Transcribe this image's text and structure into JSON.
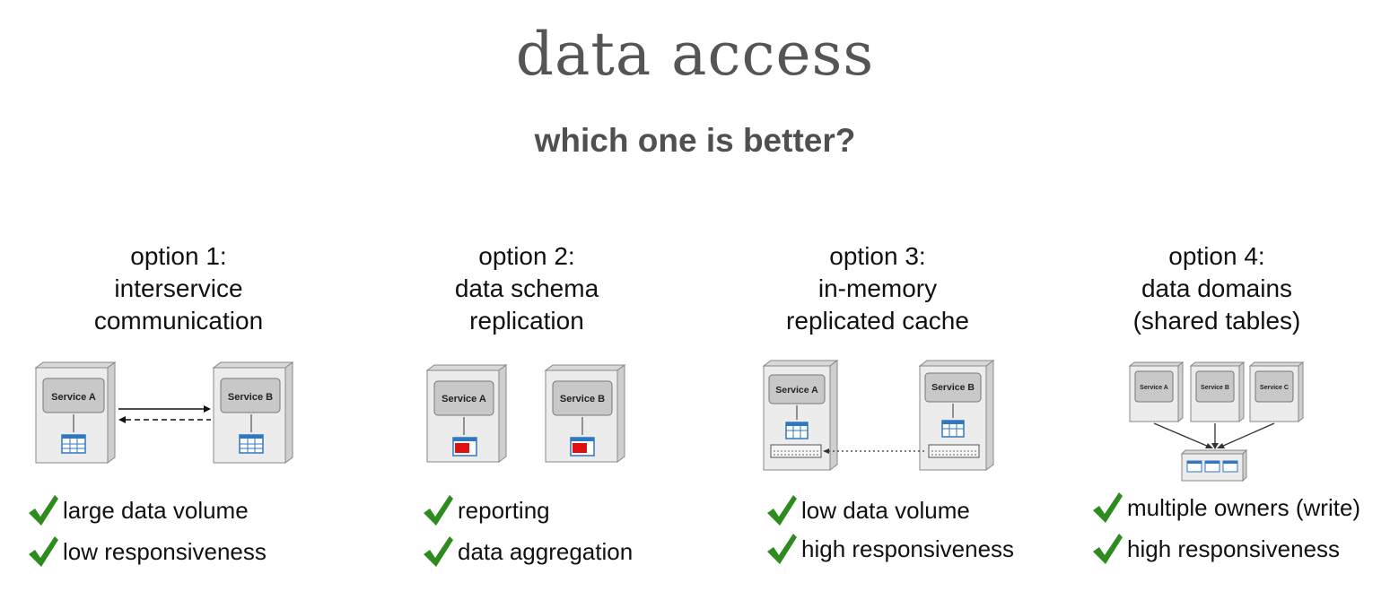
{
  "slide": {
    "title": "data access",
    "subtitle": "which one is better?"
  },
  "options": [
    {
      "heading": [
        "option 1:",
        "interservice",
        "communication"
      ],
      "services": [
        "Service A",
        "Service B"
      ],
      "pros": [
        "large data volume",
        "low responsiveness"
      ]
    },
    {
      "heading": [
        "option 2:",
        "data schema",
        "replication"
      ],
      "services": [
        "Service A",
        "Service B"
      ],
      "pros": [
        "reporting",
        "data aggregation"
      ]
    },
    {
      "heading": [
        "option 3:",
        "in-memory",
        "replicated cache"
      ],
      "services": [
        "Service A",
        "Service B"
      ],
      "pros": [
        "low data volume",
        "high responsiveness"
      ]
    },
    {
      "heading": [
        "option 4:",
        "data domains",
        "(shared tables)"
      ],
      "services": [
        "Service A",
        "Service B",
        "Service C"
      ],
      "pros": [
        "multiple owners (write)",
        "high responsiveness"
      ]
    }
  ],
  "colors": {
    "check": "#2e8b1e",
    "table_blue": "#2f77c0",
    "table_red": "#e01010",
    "server_face": "#ececec",
    "service_box": "#c8c8c8"
  },
  "icons": [
    "check-icon",
    "server-icon",
    "database-table-icon",
    "cache-icon",
    "arrow-icon"
  ]
}
